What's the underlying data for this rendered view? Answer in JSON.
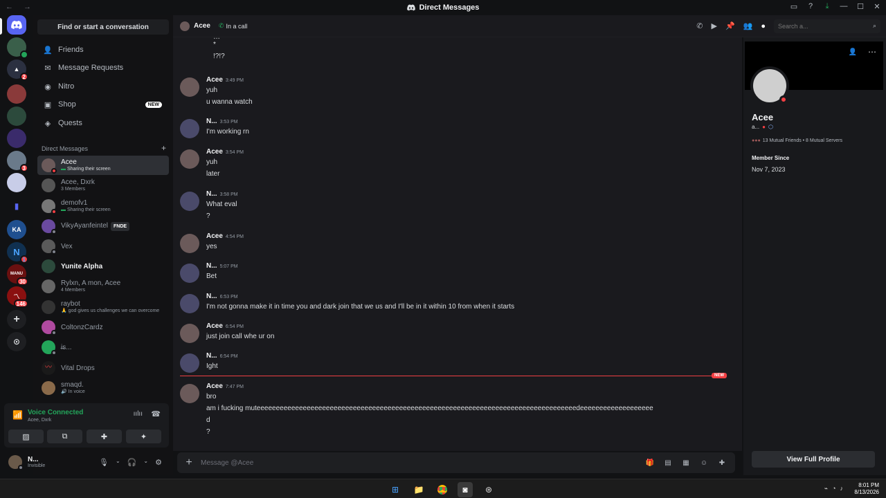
{
  "window": {
    "title": "Direct Messages",
    "nav_arrows": "← →"
  },
  "sidebar": {
    "search_button": "Find or start a conversation",
    "nav": [
      {
        "label": "Friends",
        "icon": "friends-icon"
      },
      {
        "label": "Message Requests",
        "icon": "mail-icon"
      },
      {
        "label": "Nitro",
        "icon": "nitro-icon"
      },
      {
        "label": "Shop",
        "icon": "shop-icon",
        "badge": "NEW"
      },
      {
        "label": "Quests",
        "icon": "quests-icon"
      }
    ],
    "dm_header": "Direct Messages",
    "dm_add": "+",
    "dms": [
      {
        "name": "Acee",
        "sub": "Sharing their screen"
      },
      {
        "name": "Acee, Dxrk",
        "sub": "3 Members"
      },
      {
        "name": "demofv1",
        "sub": "Sharing their screen"
      },
      {
        "name": "VikyAyanfeintel",
        "tag": "FNDE"
      },
      {
        "name": "Vex"
      },
      {
        "name": "Yunite Alpha"
      },
      {
        "name": "Rylxn, A mon, Acee",
        "sub": "4 Members"
      },
      {
        "name": "raybot",
        "sub": "god gives us challenges we can overcome"
      },
      {
        "name": "ColtonzCardz"
      },
      {
        "name": "i̶s..."
      },
      {
        "name": "Vital Drops"
      },
      {
        "name": "smaqd.",
        "sub": "In voice"
      }
    ]
  },
  "voice": {
    "status": "Voice Connected",
    "channel": "Acee, Dxrk"
  },
  "user": {
    "name": "N...",
    "status": "Invisible"
  },
  "chat_header": {
    "name": "Acee",
    "call_status": "In a call",
    "search_placeholder": "Search a..."
  },
  "messages": [
    {
      "author": "",
      "time": "",
      "lines": [
        "…",
        "*",
        "!?!?"
      ]
    },
    {
      "author": "Acee",
      "time": "3:49 PM",
      "lines": [
        "yuh",
        "u wanna watch"
      ]
    },
    {
      "author": "N...",
      "time": "3:53 PM",
      "lines": [
        "I'm working rn"
      ]
    },
    {
      "author": "Acee",
      "time": "3:54 PM",
      "lines": [
        "yuh",
        "later"
      ]
    },
    {
      "author": "N...",
      "time": "3:58 PM",
      "lines": [
        "What eval",
        "?"
      ]
    },
    {
      "author": "Acee",
      "time": "4:54 PM",
      "lines": [
        "yes"
      ]
    },
    {
      "author": "N...",
      "time": "5:07 PM",
      "lines": [
        "Bet"
      ]
    },
    {
      "author": "N...",
      "time": "6:53 PM",
      "lines": [
        "I'm not gonna make it in time you and dark join that we us and I'll be in it within 10 from when it starts"
      ]
    },
    {
      "author": "Acee",
      "time": "6:54 PM",
      "lines": [
        "just join call whe ur on"
      ]
    },
    {
      "author": "N...",
      "time": "6:54 PM",
      "lines": [
        "Ight"
      ]
    },
    {
      "author": "Acee",
      "time": "7:47 PM",
      "lines": [
        "bro",
        "am i fucking muteeeeeeeeeeeeeeeeeeeeeeeeeeeeeeeeeeeeeeeeeeeeeeeeeeeeeeeeeeeeeeeeeeeeeeeeeeeeeeeeeeedeeeeeeeeeeeeeeeeeee",
        "d",
        "?"
      ]
    }
  ],
  "new_divider": "NEW",
  "composer": {
    "placeholder": "Message @Acee"
  },
  "profile": {
    "name": "Acee",
    "tag": "a...",
    "mutuals": "13 Mutual Friends • 8 Mutual Servers",
    "member_since_label": "Member Since",
    "member_since": "Nov 7, 2023",
    "view_full": "View Full Profile"
  },
  "rail_badges": [
    "2",
    "3",
    "1",
    "30",
    "146"
  ],
  "rail_labels": {
    "ka": "KA",
    "nf": "N",
    "manu": "MANU"
  },
  "taskbar": {
    "time": "8:01 PM",
    "date": "8/13/2026"
  },
  "colors": {
    "blurple": "#5865f2",
    "green": "#23a55a",
    "red": "#f23f43"
  }
}
